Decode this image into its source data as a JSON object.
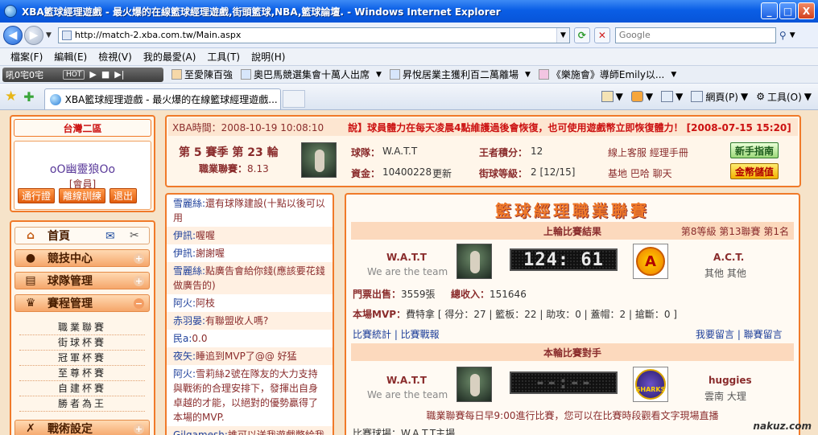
{
  "window": {
    "title": "XBA籃球經理遊戲 - 最火爆的在線籃球經理遊戲,街頭籃球,NBA,籃球論壇. - Windows Internet Explorer",
    "controls": [
      "_",
      "□",
      "X"
    ]
  },
  "address": {
    "url": "http://match-2.xba.com.tw/Main.aspx",
    "search_placeholder": "Google"
  },
  "menu": [
    "檔案(F)",
    "編輯(E)",
    "檢視(V)",
    "我的最愛(A)",
    "工具(T)",
    "說明(H)"
  ],
  "links": {
    "radio_label": "吼0宅0宅",
    "radio_hot": "HOT",
    "items": [
      "至愛陳百強",
      "奧巴馬競選集會十萬人出席",
      "昇悅居業主獲利百二萬離場",
      "《樂施會》導師Emily以..."
    ]
  },
  "tabs": {
    "active_title": "XBA籃球經理遊戲 - 最火爆的在線籃球經理遊戲...",
    "page_label": "網頁(P)",
    "tools_label": "工具(O)"
  },
  "sidebar": {
    "region": "台灣二區",
    "username": "oO幽靈狼Oo",
    "role": "[會員]",
    "buttons": [
      "通行證",
      "離線訓練",
      "退出"
    ],
    "nav": [
      "首頁",
      "競技中心",
      "球隊管理",
      "賽程管理",
      "戰術設定"
    ],
    "submenu": [
      "職業聯賽",
      "街球杯賽",
      "冠軍杯賽",
      "至尊杯賽",
      "自建杯賽",
      "勝者為王"
    ]
  },
  "info": {
    "time": "XBA時間：2008-10-19 10:08:10",
    "announcement": "說】球員體力在每天凌晨4點維護過後會恢復，也可使用遊戲幣立即恢復體力！ [2008-07-15 15:20]",
    "season": "第 5 賽季 第 23 輪",
    "league_label": "職業聯賽：",
    "league_value": "8.13",
    "team_label": "球隊：",
    "team_value": "W.A.T.T",
    "funds_label": "資金：",
    "funds_value": "10400228",
    "funds_link": "更新",
    "king_label": "王者積分：",
    "king_value": "12",
    "street_label": "街球等級：",
    "street_value": "2 [12/15]",
    "service_links": "線上客服  經理手冊",
    "base_links": "基地  巴哈  聊天",
    "newbie_button": "新手指南",
    "gold_button": "金幣儲值"
  },
  "chat": [
    {
      "nick": "雪麗絲:",
      "text": "還有球隊建設(十點以後可以用"
    },
    {
      "nick": "伊訊:",
      "text": "喔喔"
    },
    {
      "nick": "伊訊:",
      "text": "謝謝喔"
    },
    {
      "nick": "雪麗絲:",
      "text": "點廣告會給你錢(應該要花錢做廣告的)"
    },
    {
      "nick": "阿火:",
      "text": "阿枝"
    },
    {
      "nick": "赤羽晏:",
      "text": "有聯盟收人嗎?"
    },
    {
      "nick": "民a:",
      "text": "0.0"
    },
    {
      "nick": "夜矢:",
      "text": "睡追到MVP了@@  好猛"
    },
    {
      "nick": "阿火:",
      "text": "雪莉絲2號在隊友的大力支持與戰術的合理安排下，發揮出自身卓越的才能，以絕對的優勢贏得了本場的MVP."
    },
    {
      "nick": "Gilgamesh:",
      "text": "誰可以送我遊戲幣給我"
    }
  ],
  "league": {
    "banner": "籃球經理職業聯賽",
    "last_title": "上輪比賽結果",
    "last_right": "第8等級  第13聯賽  第1名",
    "home_team": "W.A.T.T",
    "home_slogan": "We are the team",
    "last_score": "124: 61",
    "away_team": "A.C.T.",
    "away_sub": "其他  其他",
    "tickets_label": "門票出售：",
    "tickets_value": "3559張",
    "income_label": "總收入：",
    "income_value": "151646",
    "mvp_label": "本場MVP：",
    "mvp_value": "費特拿  [ 得分：27 | 籃板：22 | 助攻：0 | 蓋帽：2 | 搶斷：0 ]",
    "stats_links": "比賽統計 | 比賽戰報",
    "comment_links": "我要留言 | 聯賽留言",
    "next_title": "本輪比賽對手",
    "next_score": "--:--",
    "next_team": "huggies",
    "next_sub": "雲南  大理",
    "sharks_text": "SHARKS",
    "notice": "職業聯賽每日早9:00進行比賽，您可以在比賽時段觀看文字現場直播",
    "venue": "比賽球場：W.A.T.T主場"
  },
  "watermark": "nakuz.com"
}
